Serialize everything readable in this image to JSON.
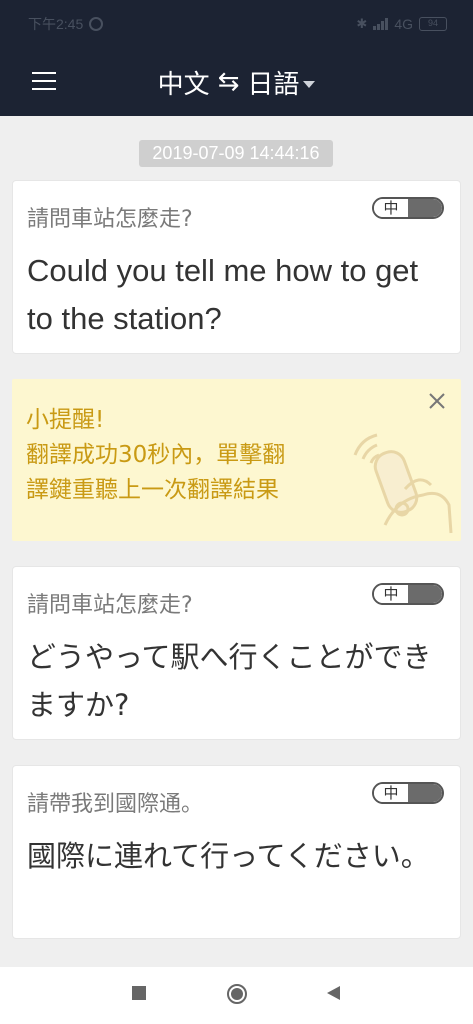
{
  "status_bar": {
    "time": "下午2:45",
    "network": "4G",
    "battery": "94"
  },
  "header": {
    "source_lang": "中文",
    "swap_symbol": "⇆",
    "target_lang": "日語"
  },
  "timestamp": "2019-07-09 14:44:16",
  "cards": [
    {
      "source_text": "請問車站怎麼走?",
      "translation": "Could you tell me how to get to the station?",
      "toggle_label": "中"
    },
    {
      "source_text": "請問車站怎麼走?",
      "translation": "どうやって駅へ行くことができますか?",
      "toggle_label": "中"
    },
    {
      "source_text": "請帶我到國際通。",
      "translation": "國際に連れて行ってください。",
      "toggle_label": "中"
    }
  ],
  "tip": {
    "title": "小提醒!",
    "line1": "翻譯成功30秒內，單擊翻",
    "line2": "譯鍵重聽上一次翻譯結果"
  },
  "colors": {
    "header_bg": "#1c2333",
    "tip_bg": "#fdf7d0",
    "tip_text": "#c99a14",
    "page_bg": "#efefef"
  }
}
